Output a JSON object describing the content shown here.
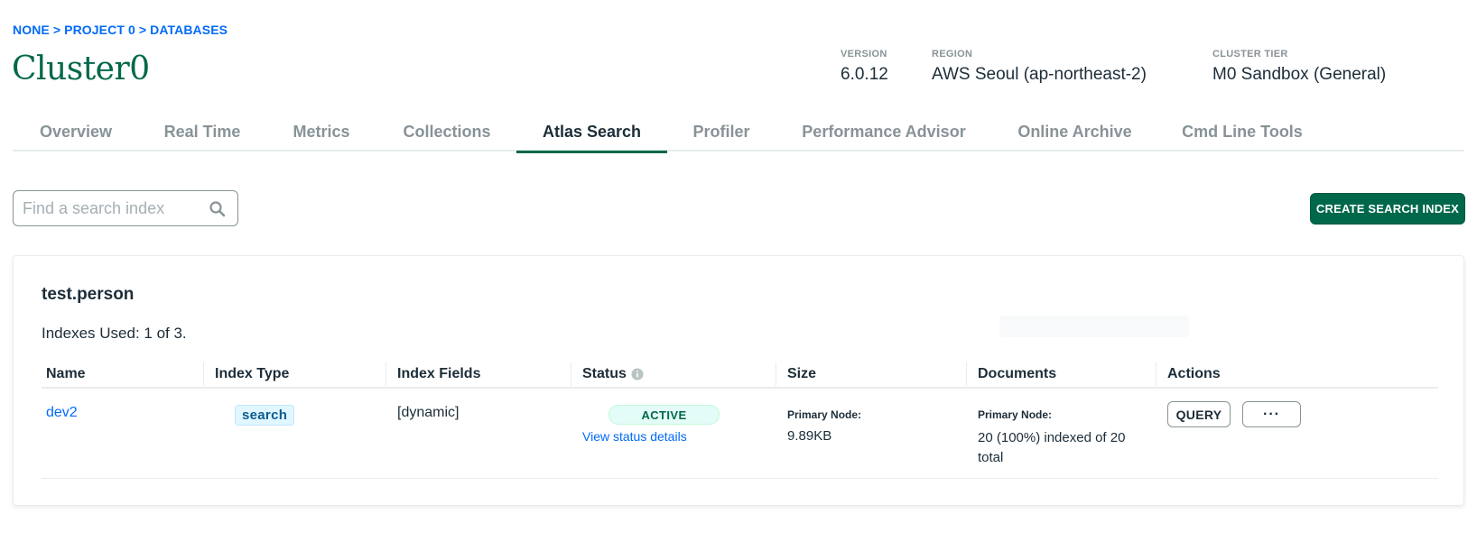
{
  "breadcrumb": {
    "org": "NONE",
    "sep1": ">",
    "project": "PROJECT 0",
    "sep2": ">",
    "section": "DATABASES"
  },
  "page_title": "Cluster0",
  "meta": {
    "version_label": "VERSION",
    "version_value": "6.0.12",
    "region_label": "REGION",
    "region_value": "AWS Seoul (ap-northeast-2)",
    "tier_label": "CLUSTER TIER",
    "tier_value": "M0 Sandbox (General)"
  },
  "tabs": [
    {
      "label": "Overview"
    },
    {
      "label": "Real Time"
    },
    {
      "label": "Metrics"
    },
    {
      "label": "Collections"
    },
    {
      "label": "Atlas Search",
      "active": true
    },
    {
      "label": "Profiler"
    },
    {
      "label": "Performance Advisor"
    },
    {
      "label": "Online Archive"
    },
    {
      "label": "Cmd Line Tools"
    }
  ],
  "search": {
    "placeholder": "Find a search index",
    "value": ""
  },
  "create_button": "CREATE SEARCH INDEX",
  "card": {
    "title": "test.person",
    "indexes_used": "Indexes Used: 1 of 3.",
    "columns": [
      "Name",
      "Index Type",
      "Index Fields",
      "Status",
      "Size",
      "Documents",
      "Actions"
    ],
    "rows": [
      {
        "name": "dev2",
        "index_type": "search",
        "index_fields": "[dynamic]",
        "status": "ACTIVE",
        "status_link": "View status details",
        "size_label": "Primary Node:",
        "size_value": "9.89KB",
        "docs_label": "Primary Node:",
        "docs_value": "20 (100%) indexed of 20 total",
        "action_query": "QUERY",
        "action_more": "···"
      }
    ]
  },
  "colors": {
    "accent": "#00684a",
    "link": "#016bf8",
    "muted": "#889397"
  },
  "icons": {
    "search": "magnifier-icon",
    "info": "info-icon",
    "more": "ellipsis-icon"
  }
}
